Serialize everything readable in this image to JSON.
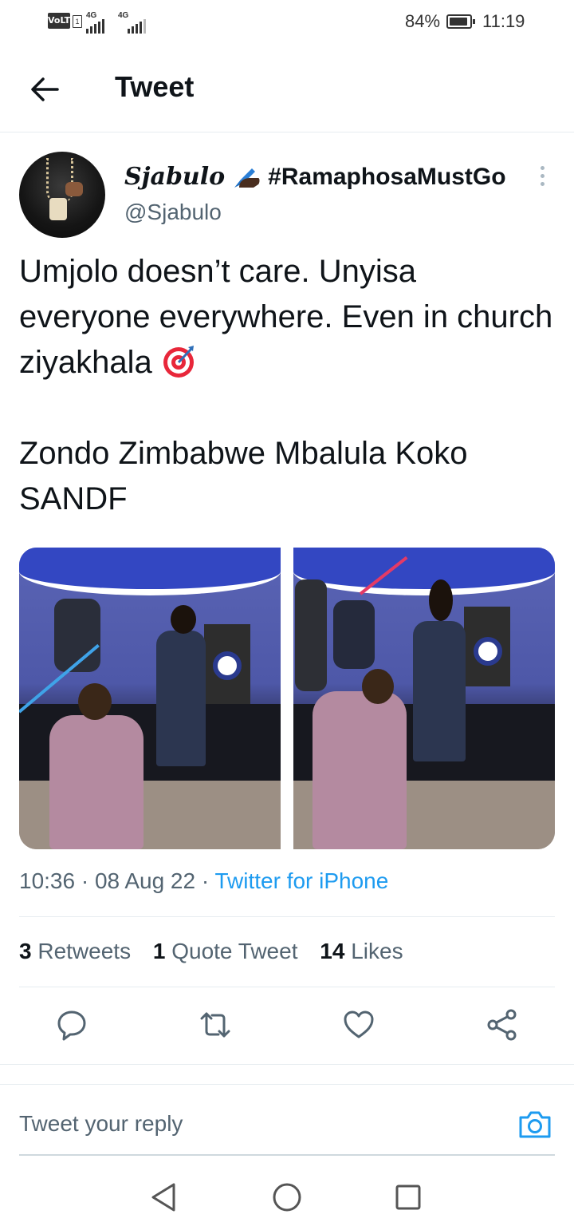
{
  "status_bar": {
    "volte": "VoLTE",
    "sim": "1",
    "network1": "4G",
    "network2": "4G",
    "battery": "84%",
    "time": "11:19"
  },
  "header": {
    "title": "Tweet",
    "back_icon": "arrow-left-icon"
  },
  "tweet": {
    "author": {
      "name_script": "Sjabulo",
      "name_emoji": "writing-hand",
      "name_hashtag": "#RamaphosaMustGo",
      "handle": "@Sjabulo"
    },
    "text_line1": "Umjolo doesn’t care. Unyisa everyone everywhere. Even in church ziyakhala",
    "text_emoji": "direct-hit-target",
    "text_line2": "Zondo Zimbabwe Mbalula Koko SANDF",
    "timestamp": "10:36 · 08 Aug 22 · ",
    "source": "Twitter for iPhone",
    "stats": {
      "retweets_count": "3",
      "retweets_label": "Retweets",
      "quotes_count": "1",
      "quotes_label": "Quote Tweet",
      "likes_count": "14",
      "likes_label": "Likes"
    },
    "actions": [
      "reply-icon",
      "retweet-icon",
      "like-icon",
      "share-icon"
    ]
  },
  "reply": {
    "placeholder": "Tweet your reply",
    "camera_icon": "camera-icon"
  },
  "nav": [
    "back-triangle-icon",
    "home-circle-icon",
    "recents-square-icon"
  ],
  "colors": {
    "accent": "#1d9bf0",
    "text": "#0f1419",
    "secondary": "#536471",
    "divider": "#e6ecf0"
  }
}
